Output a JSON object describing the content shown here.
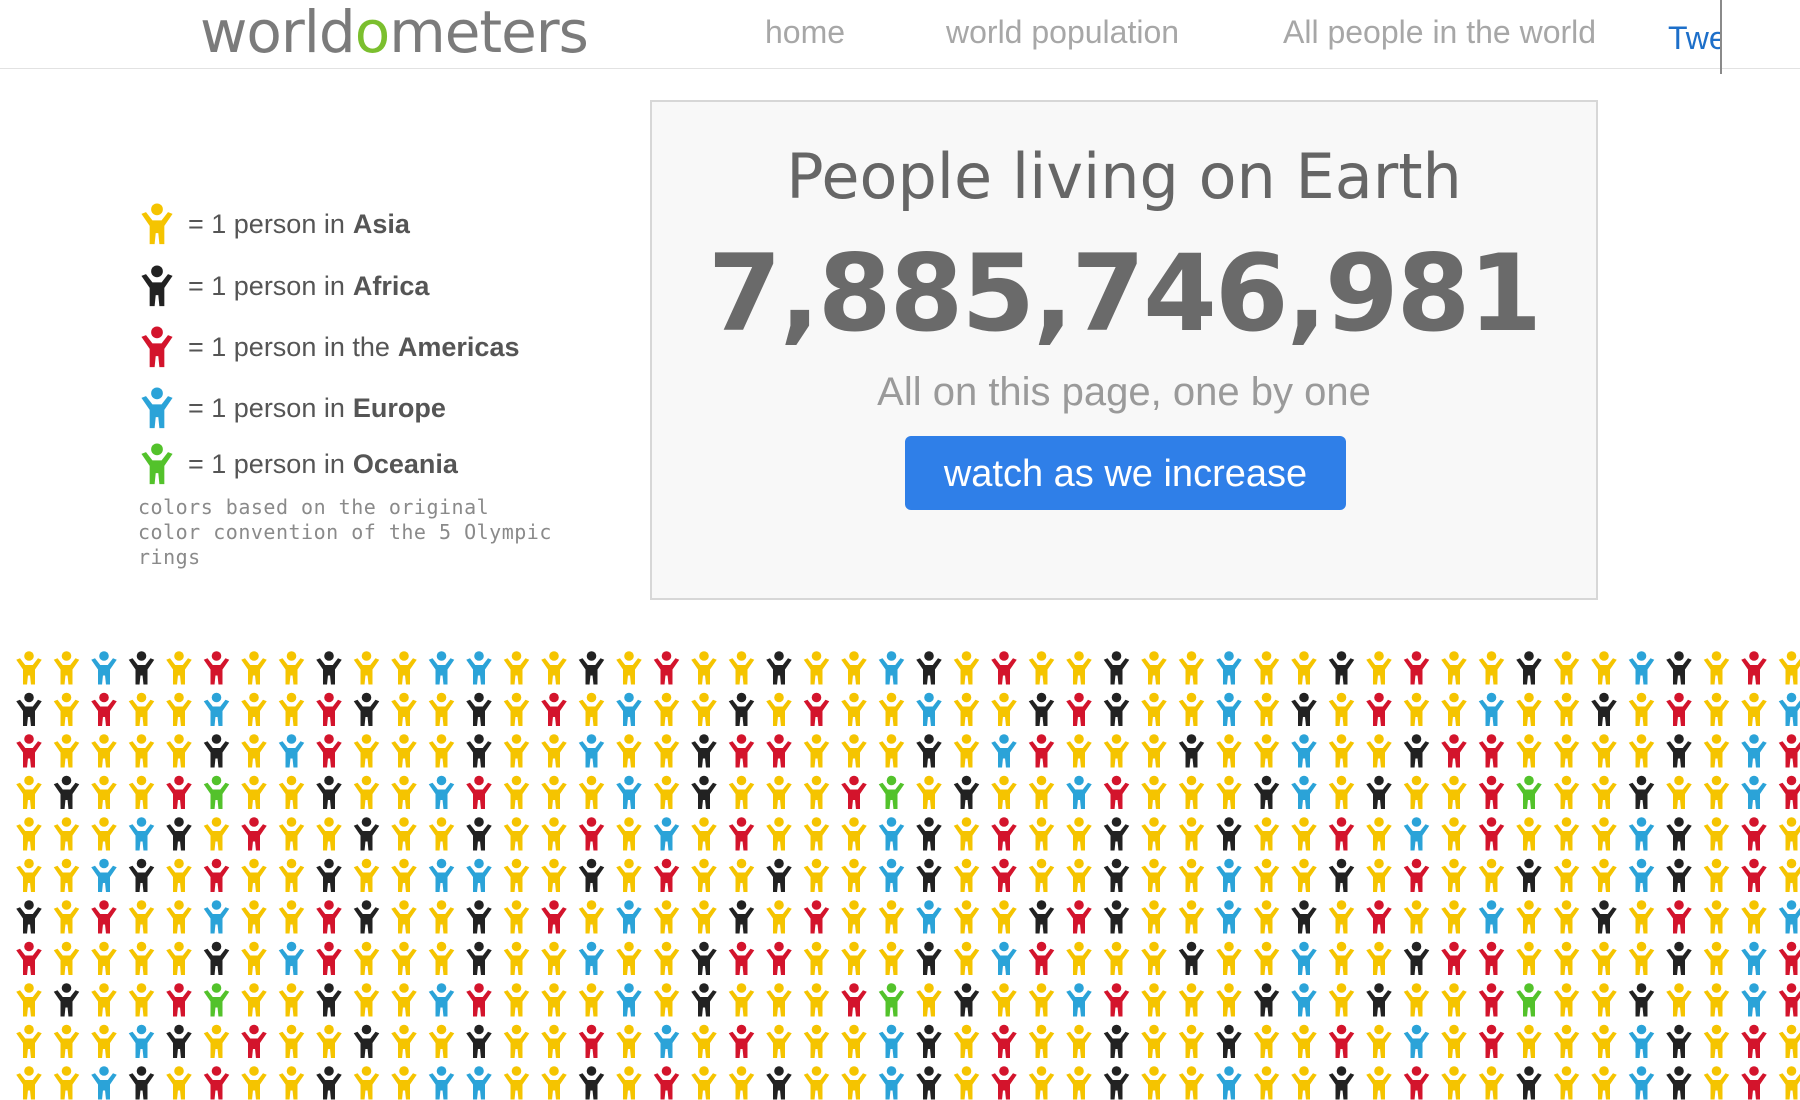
{
  "header": {
    "logo_pre": "worldo",
    "logo_accent": "o",
    "logo_post": "meters",
    "nav": [
      {
        "label": "home"
      },
      {
        "label": "world population"
      },
      {
        "label": "All people in the world"
      }
    ],
    "tweet_label": "Tweet"
  },
  "legend": {
    "items": [
      {
        "prefix": "= 1 person in",
        "region": "Asia",
        "color": "#f5c400"
      },
      {
        "prefix": "= 1 person in",
        "region": "Africa",
        "color": "#222222"
      },
      {
        "prefix": "= 1 person in the",
        "region": "Americas",
        "color": "#d3142c"
      },
      {
        "prefix": "= 1 person in",
        "region": "Europe",
        "color": "#2ba3d8"
      },
      {
        "prefix": "= 1 person in",
        "region": "Oceania",
        "color": "#53c22b"
      }
    ],
    "note": "colors based on the original color convention of the 5 Olympic rings"
  },
  "counter": {
    "title": "People living on Earth",
    "number": "7,885,746,981",
    "subtitle": "All on this page, one by one",
    "button_label": "watch as we increase"
  },
  "crowd": {
    "rows": 11,
    "cols": 48,
    "palette": {
      "A": "#f5c400",
      "F": "#222222",
      "M": "#d3142c",
      "E": "#2ba3d8",
      "O": "#53c22b"
    },
    "pattern": [
      "AAEFAMAAFAAEEAAFAMAAFAAEFAMAAFAAEAAFAMAAFAAEFAMA",
      "FAMAAEAAMFAAFAMAEAAFAMAAEAAFMFAAEAFAMAAEAAFAMAAE",
      "MAAAAFAEMAAAFAAEAAFMMAAAFAEMAAAFAAEAAFMMAAAAFAEM",
      "AFAAMOAAFAAEMAAAEAFAAAMOAFAAEMAAAFEAFAAMOAAFAAEM",
      "AAAEFAMAAFAAFAAMAEAMAAAEFAMAAFAAFAAMAEAMAAAEFAMA",
      "AAEFAMAAFAAEEAAFAMAAFAAEFAMAAFAAEAAFAMAAFAAEFAMA",
      "FAMAAEAAMFAAFAMAEAAFAMAAEAAFMFAAEAFAMAAEAAFAMAAE",
      "MAAAAFAEMAAAFAAEAAFMMAAAFAEMAAAFAAEAAFMMAAAAFAEM",
      "AFAAMOAAFAAEMAAAEAFAAAMOAFAAEMAAAFEAFAAMOAAFAAEM",
      "AAAEFAMAAFAAFAAMAEAMAAAEFAMAAFAAFAAMAEAMAAAEFAMA",
      "AAEFAMAAFAAEEAAFAMAAFAAEFAMAAFAAEAAFAMAAFAAEFAMA"
    ]
  }
}
